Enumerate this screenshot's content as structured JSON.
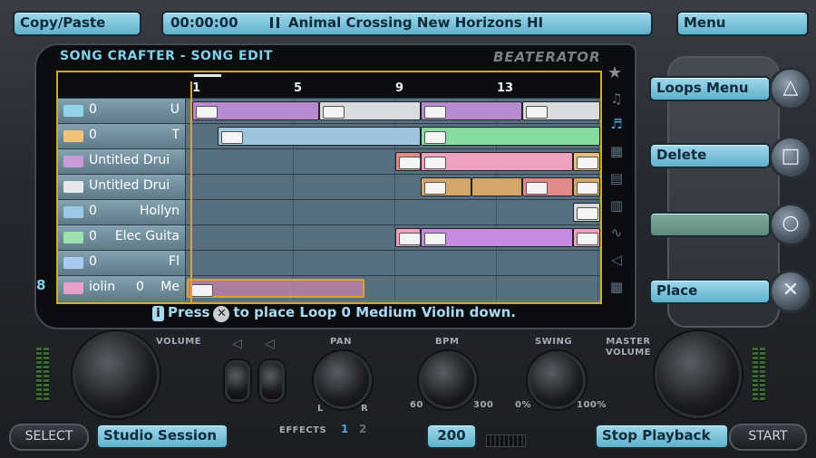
{
  "top_bar": {
    "copy_paste_label": "Copy/Paste",
    "time": "00:00:00",
    "now_playing": "Animal Crossing New Horizons HI",
    "menu_label": "Menu"
  },
  "screen": {
    "title": "SONG CRAFTER - SONG EDIT",
    "logo": "BEATERATOR"
  },
  "ruler_marks": [
    "1",
    "5",
    "9",
    "13"
  ],
  "lanes": [
    {
      "num": "0",
      "name": "U",
      "icon_color": "#8fd2ea"
    },
    {
      "num": "0",
      "name": "T",
      "icon_color": "#f2c27a"
    },
    {
      "num": "",
      "name": "Untitled Drui",
      "icon_color": "#c89ad8"
    },
    {
      "num": "",
      "name": "Untitled Drui",
      "icon_color": "#e8e8e8"
    },
    {
      "num": "0",
      "name": "Hollyn",
      "icon_color": "#9cc8e8"
    },
    {
      "num": "0",
      "name": "Elec Guita",
      "icon_color": "#9de0b0"
    },
    {
      "num": "0",
      "name": "Fl",
      "icon_color": "#a9c9f0"
    },
    {
      "num": "0",
      "name": "Me",
      "prefix": "iolin",
      "icon_color": "#e7a0c8"
    }
  ],
  "side_menu": {
    "loops_menu_label": "Loops Menu",
    "delete_label": "Delete",
    "place_label": "Place"
  },
  "hint": {
    "press": "Press",
    "text": "to place Loop 0  Medium Violin down."
  },
  "console": {
    "volume_label": "VOLUME",
    "pan_label": "PAN",
    "pan_l": "L",
    "pan_r": "R",
    "effects_label": "EFFECTS",
    "effects_1": "1",
    "effects_2": "2",
    "bpm_label": "BPM",
    "bpm_min": "60",
    "bpm_max": "300",
    "swing_label": "SWING",
    "swing_min": "0%",
    "swing_max": "100%",
    "master_volume_label": "MASTER VOLUME",
    "lane_number": "8"
  },
  "bottom_bar": {
    "select_label": "SELECT",
    "studio_session_label": "Studio Session",
    "bpm_value": "200",
    "stop_playback_label": "Stop Playback",
    "start_label": "START"
  }
}
